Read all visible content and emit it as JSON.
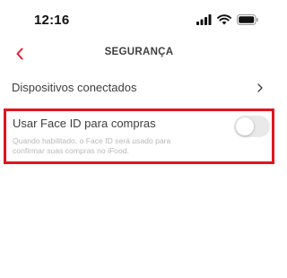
{
  "status_bar": {
    "time": "12:16",
    "icons": [
      "signal-icon",
      "wifi-icon",
      "battery-icon"
    ]
  },
  "header": {
    "title": "SEGURANÇA",
    "back_icon": "chevron-left-icon",
    "accent_color": "#ea1d2c"
  },
  "settings": {
    "devices": {
      "label": "Dispositivos conectados",
      "icon": "chevron-right-icon"
    },
    "face_id": {
      "label": "Usar Face ID para compras",
      "description": "Quando habilitado, o Face ID será usado para confirmar suas compras no iFood.",
      "enabled": false,
      "highlight_color": "#e2151e"
    }
  }
}
